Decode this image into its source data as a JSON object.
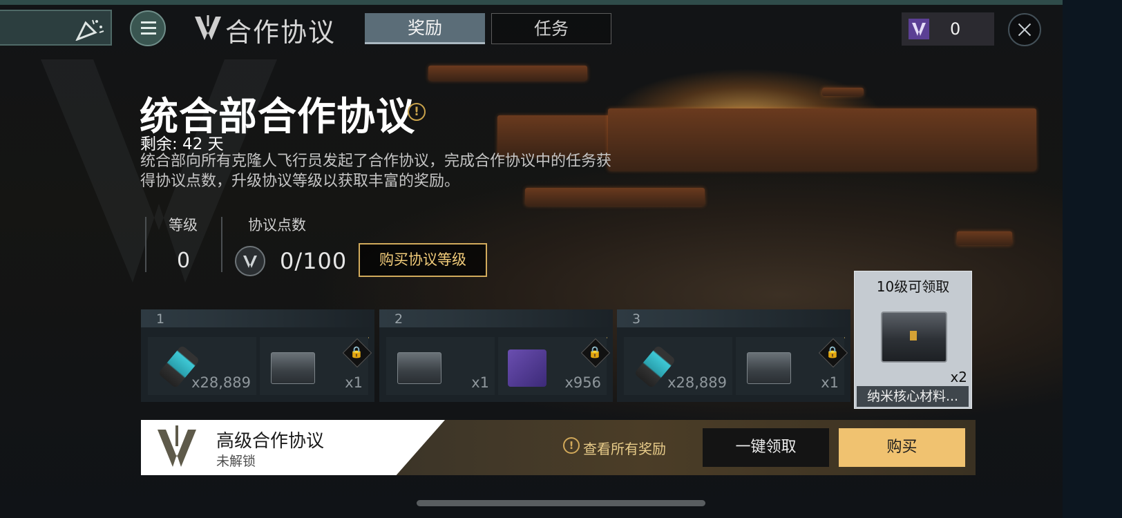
{
  "header": {
    "title": "合作协议",
    "tabs": [
      {
        "label": "奖励",
        "active": true
      },
      {
        "label": "任务",
        "active": false
      }
    ],
    "currency_value": "0",
    "icons": [
      "party-popper-icon",
      "menu-icon",
      "emblem-icon",
      "protocol-token-icon",
      "close-icon"
    ]
  },
  "hero": {
    "title": "统合部合作协议",
    "remaining": "剩余: 42 天",
    "description": "统合部向所有克隆人飞行员发起了合作协议，完成合作协议中的任务获得协议点数，升级协议等级以获取丰富的奖励。",
    "level_label": "等级",
    "level_value": "0",
    "points_label": "协议点数",
    "points_value": "0/100",
    "points_progress": 0,
    "buy_level_label": "购买协议等级"
  },
  "reward_levels": [
    {
      "level": "1",
      "free": {
        "item": "canister",
        "qty": "x28,889"
      },
      "premium": {
        "item": "chest",
        "qty": "x1",
        "locked": true
      }
    },
    {
      "level": "2",
      "free": {
        "item": "chest",
        "qty": "x1"
      },
      "premium": {
        "item": "purple-card",
        "qty": "x956",
        "locked": true
      }
    },
    {
      "level": "3",
      "free": {
        "item": "canister",
        "qty": "x28,889"
      },
      "premium": {
        "item": "chest",
        "qty": "x1",
        "locked": true
      }
    }
  ],
  "milestone": {
    "title": "10级可领取",
    "qty": "x2",
    "name": "纳米核心材料..."
  },
  "premium_banner": {
    "title": "高级合作协议",
    "status": "未解锁",
    "view_all": "查看所有奖励",
    "claim_all": "一键领取",
    "buy": "购买"
  },
  "colors": {
    "gold": "#d2ab5c",
    "buy_button": "#f0c270",
    "active_tab": "#5b6d78",
    "token_purple": "#5b3f94"
  }
}
